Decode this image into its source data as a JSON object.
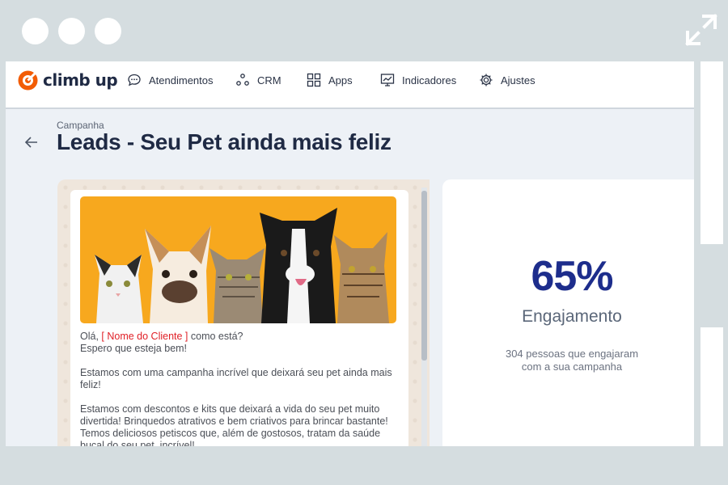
{
  "window": {
    "controls": [
      "window-dot",
      "window-dot",
      "window-dot"
    ],
    "expand_icon": "expand-arrows-icon"
  },
  "brand": {
    "name": "climb up",
    "accent": "#f25c05"
  },
  "nav": {
    "items": [
      {
        "label": "Atendimentos",
        "icon": "chat-bubble-icon"
      },
      {
        "label": "CRM",
        "icon": "nodes-icon"
      },
      {
        "label": "Apps",
        "icon": "grid-icon"
      },
      {
        "label": "Indicadores",
        "icon": "chart-board-icon"
      },
      {
        "label": "Ajustes",
        "icon": "gear-icon"
      }
    ]
  },
  "page": {
    "eyebrow": "Campanha",
    "title": "Leads - Seu Pet ainda mais feliz"
  },
  "message": {
    "greeting_prefix": "Olá, ",
    "name_token": "[ Nome do Cliente ]",
    "greeting_suffix": " como está?",
    "line2": "Espero que esteja bem!",
    "para2": "Estamos com uma campanha incrível que deixará seu pet ainda mais feliz!",
    "para3": "Estamos com descontos e kits que deixará a vida do seu pet muito divertida! Brinquedos atrativos e bem criativos para brincar bastante! Temos deliciosos petiscos que, além de gostosos, tratam da saúde bucal do seu pet, incrível!",
    "hero_background": "#f7a81e"
  },
  "engagement": {
    "value": "65%",
    "label": "Engajamento",
    "desc_line1": "304 pessoas que engajaram",
    "desc_line2": "com a sua campanha",
    "color": "#1d2d8c"
  }
}
